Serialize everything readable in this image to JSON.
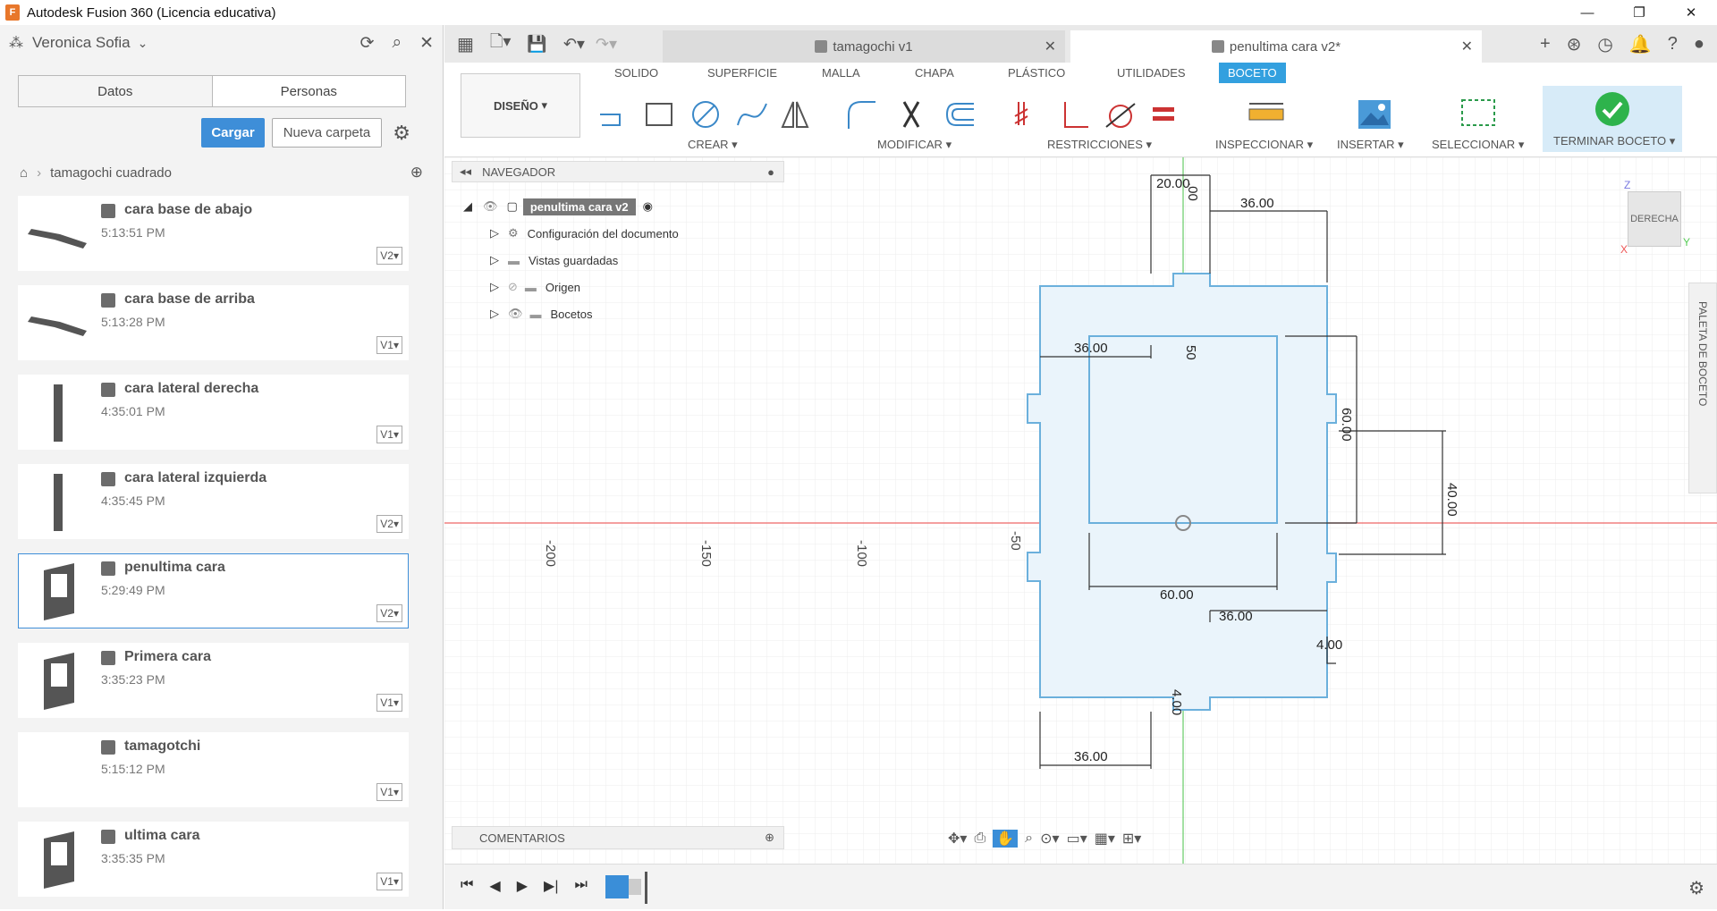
{
  "app": {
    "title": "Autodesk Fusion 360 (Licencia educativa)"
  },
  "data_panel": {
    "user": "Veronica Sofia",
    "tabs": [
      "Datos",
      "Personas"
    ],
    "upload_label": "Cargar",
    "new_folder_label": "Nueva carpeta",
    "breadcrumb": "tamagochi cuadrado",
    "files": [
      {
        "name": "cara base de abajo",
        "time": "5:13:51 PM",
        "version": "V2"
      },
      {
        "name": "cara base de arriba",
        "time": "5:13:28 PM",
        "version": "V1"
      },
      {
        "name": "cara lateral derecha",
        "time": "4:35:01 PM",
        "version": "V1"
      },
      {
        "name": "cara lateral izquierda",
        "time": "4:35:45 PM",
        "version": "V2"
      },
      {
        "name": "penultima cara",
        "time": "5:29:49 PM",
        "version": "V2"
      },
      {
        "name": "Primera cara",
        "time": "3:35:23 PM",
        "version": "V1"
      },
      {
        "name": "tamagotchi",
        "time": "5:15:12 PM",
        "version": "V1"
      },
      {
        "name": "ultima cara",
        "time": "3:35:35 PM",
        "version": "V1"
      }
    ]
  },
  "tabs": [
    {
      "label": "tamagochi v1"
    },
    {
      "label": "penultima cara v2*"
    }
  ],
  "ribbon": {
    "workspace": "DISEÑO",
    "tabs": [
      "SOLIDO",
      "SUPERFICIE",
      "MALLA",
      "CHAPA",
      "PLÁSTICO",
      "UTILIDADES",
      "BOCETO"
    ],
    "groups": [
      "CREAR",
      "MODIFICAR",
      "RESTRICCIONES",
      "INSPECCIONAR",
      "INSERTAR",
      "SELECCIONAR",
      "TERMINAR BOCETO"
    ]
  },
  "navigator": {
    "title": "NAVEGADOR",
    "root": "penultima cara v2",
    "items": [
      "Configuración del documento",
      "Vistas guardadas",
      "Origen",
      "Bocetos"
    ]
  },
  "comments": "COMENTARIOS",
  "viewcube": {
    "face": "DERECHA",
    "axis_x": "X",
    "axis_y": "Y",
    "axis_z": "Z"
  },
  "palette": "PALETA DE BOCETO",
  "axis_ticks": [
    "-200",
    "-150",
    "-100",
    "-50"
  ],
  "dimensions": [
    "20.00",
    "36.00",
    "36.00",
    "60.00",
    "40.00",
    "60.00",
    "36.00",
    "4.00",
    "4.00",
    "36.00",
    "50",
    ".00"
  ]
}
